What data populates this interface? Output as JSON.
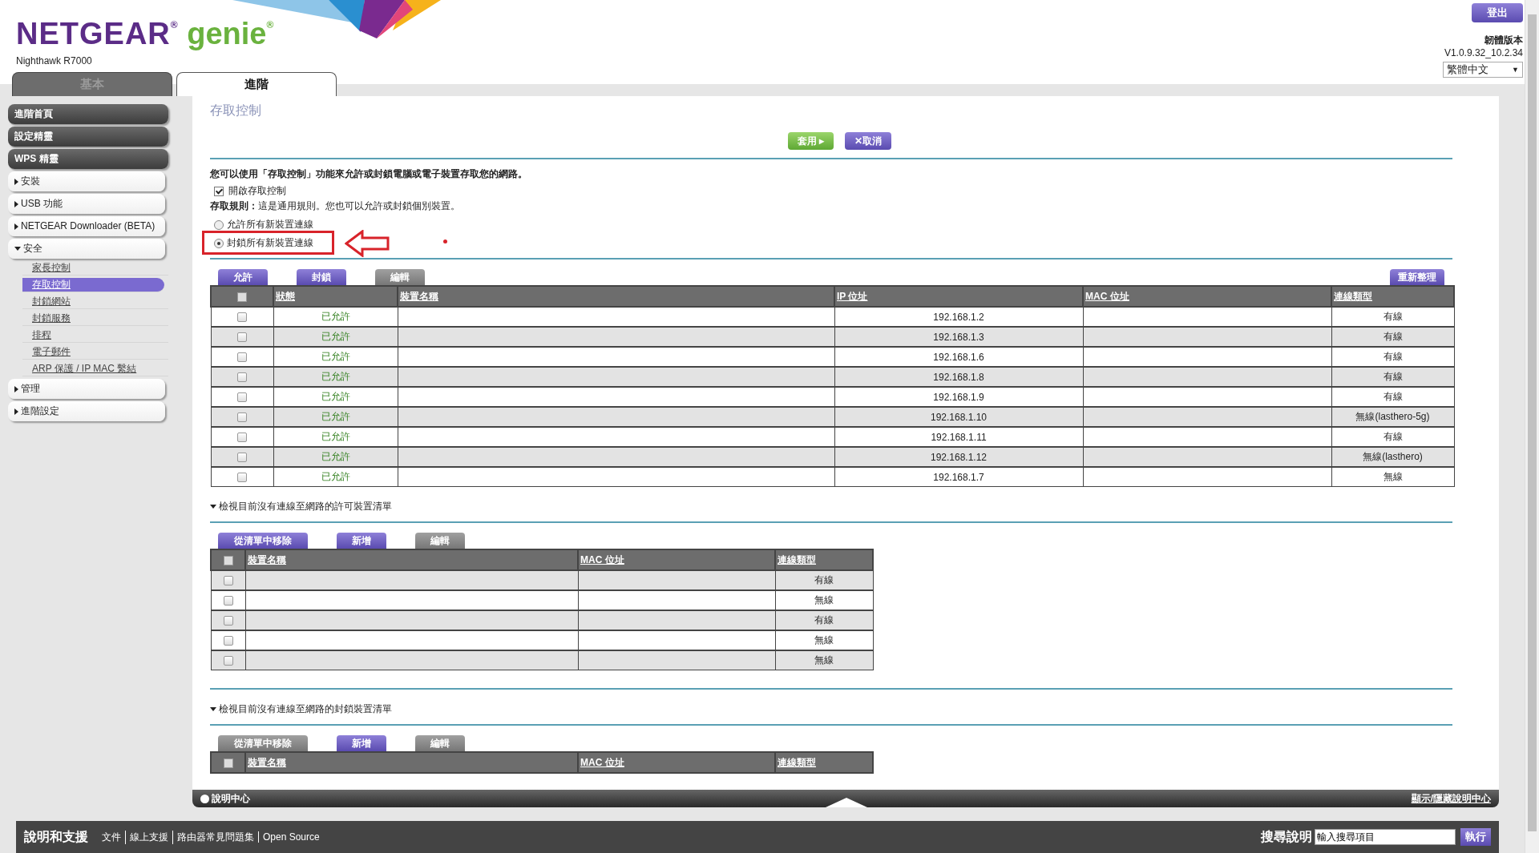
{
  "header": {
    "brand": "NETGEAR$^{®}$",
    "product": "genie$^{®}$",
    "model": "Nighthawk R7000",
    "logout": "登出",
    "firmware_label": "韌體版本",
    "firmware_version": "V1.0.9.32_10.2.34",
    "language": {
      "value": "繁體中文",
      "caret": "▼"
    }
  },
  "tabs": [
    {
      "label": "基本",
      "selected": false
    },
    {
      "label": "進階",
      "selected": true
    }
  ],
  "sidebar": [
    {
      "label": "進階首頁",
      "kind": "dark"
    },
    {
      "label": "設定精靈",
      "kind": "dark"
    },
    {
      "label": "WPS 精靈",
      "kind": "dark"
    },
    {
      "label": "安裝",
      "kind": "menu",
      "expanded": false
    },
    {
      "label": "USB 功能",
      "kind": "menu",
      "expanded": false
    },
    {
      "label": "NETGEAR Downloader (BETA)",
      "kind": "menu",
      "expanded": false
    },
    {
      "label": "安全",
      "kind": "menu",
      "expanded": true,
      "children": [
        {
          "label": "家長控制",
          "selected": false
        },
        {
          "label": "存取控制",
          "selected": true
        },
        {
          "label": "封鎖網站",
          "selected": false
        },
        {
          "label": "封鎖服務",
          "selected": false
        },
        {
          "label": "排程",
          "selected": false
        },
        {
          "label": "電子郵件",
          "selected": false
        },
        {
          "label": "ARP 保護 / IP MAC 繫結",
          "selected": false
        }
      ]
    },
    {
      "label": "管理",
      "kind": "menu",
      "expanded": false
    },
    {
      "label": "進階設定",
      "kind": "menu",
      "expanded": false
    }
  ],
  "page": {
    "title": "存取控制",
    "actions": [
      {
        "label": "套用 ▸",
        "kind": "apply"
      },
      {
        "label": "✕取消",
        "kind": "cancel"
      }
    ],
    "intro": "您可以使用「存取控制」功能來允許或封鎖電腦或電子裝置存取您的網路。",
    "enable": {
      "label": "開啟存取控制",
      "checked": true
    },
    "rule": "**存取規則：**這是通用規則。您也可以允許或封鎖個別裝置。",
    "radios": [
      {
        "label": "允許所有新裝置連線",
        "selected": false
      },
      {
        "label": "封鎖所有新裝置連線",
        "selected": true
      }
    ]
  },
  "devices": {
    "buttons": [
      {
        "label": "允許",
        "disabled": false
      },
      {
        "label": "封鎖",
        "disabled": false
      },
      {
        "label": "編輯",
        "disabled": true
      }
    ],
    "refresh": "重新整理",
    "select_all_checked": false,
    "columns": [
      "狀態",
      "裝置名稱",
      "IP 位址",
      "MAC 位址",
      "連線類型"
    ],
    "rows": [
      {
        "checked": false,
        "status": "已允許",
        "ip": "192.168.1.2",
        "type": "有線"
      },
      {
        "checked": false,
        "status": "已允許",
        "ip": "192.168.1.3",
        "type": "有線"
      },
      {
        "checked": false,
        "status": "已允許",
        "ip": "192.168.1.6",
        "type": "有線"
      },
      {
        "checked": false,
        "status": "已允許",
        "ip": "192.168.1.8",
        "type": "有線"
      },
      {
        "checked": false,
        "status": "已允許",
        "ip": "192.168.1.9",
        "type": "有線"
      },
      {
        "checked": false,
        "status": "已允許",
        "ip": "192.168.1.10",
        "type": "無線(lasthero-5g)"
      },
      {
        "checked": false,
        "status": "已允許",
        "ip": "192.168.1.11",
        "type": "有線"
      },
      {
        "checked": false,
        "status": "已允許",
        "ip": "192.168.1.12",
        "type": "無線(lasthero)"
      },
      {
        "checked": false,
        "status": "已允許",
        "ip": "192.168.1.7",
        "type": "無線"
      }
    ]
  },
  "lists": [
    {
      "heading": "檢視目前沒有連線至網路的許可裝置清單",
      "expanded": true,
      "select_all_checked": false,
      "buttons": [
        {
          "label": "從清單中移除",
          "disabled": false
        },
        {
          "label": "新增",
          "disabled": false
        },
        {
          "label": "編輯",
          "disabled": true
        }
      ],
      "columns": [
        "裝置名稱",
        "MAC 位址",
        "連線類型"
      ],
      "rows": [
        {
          "checked": false,
          "type": "有線"
        },
        {
          "checked": false,
          "type": "無線"
        },
        {
          "checked": false,
          "type": "有線"
        },
        {
          "checked": false,
          "type": "無線"
        },
        {
          "checked": false,
          "type": "無線"
        }
      ]
    },
    {
      "heading": "檢視目前沒有連線至網路的封鎖裝置清單",
      "expanded": true,
      "select_all_checked": false,
      "buttons": [
        {
          "label": "從清單中移除",
          "disabled": true
        },
        {
          "label": "新增",
          "disabled": false
        },
        {
          "label": "編輯",
          "disabled": true
        }
      ],
      "columns": [
        "裝置名稱",
        "MAC 位址",
        "連線類型"
      ]
    }
  ],
  "help_bar": {
    "label": "說明中心",
    "toggle": "顯示/隱藏說明中心"
  },
  "footer": {
    "title": "說明和支援",
    "links": [
      "文件",
      "線上支援",
      "路由器常見問題集",
      "Open Source"
    ],
    "search_label": "搜尋說明",
    "search_placeholder": "輸入搜尋項目",
    "go": "執行"
  }
}
